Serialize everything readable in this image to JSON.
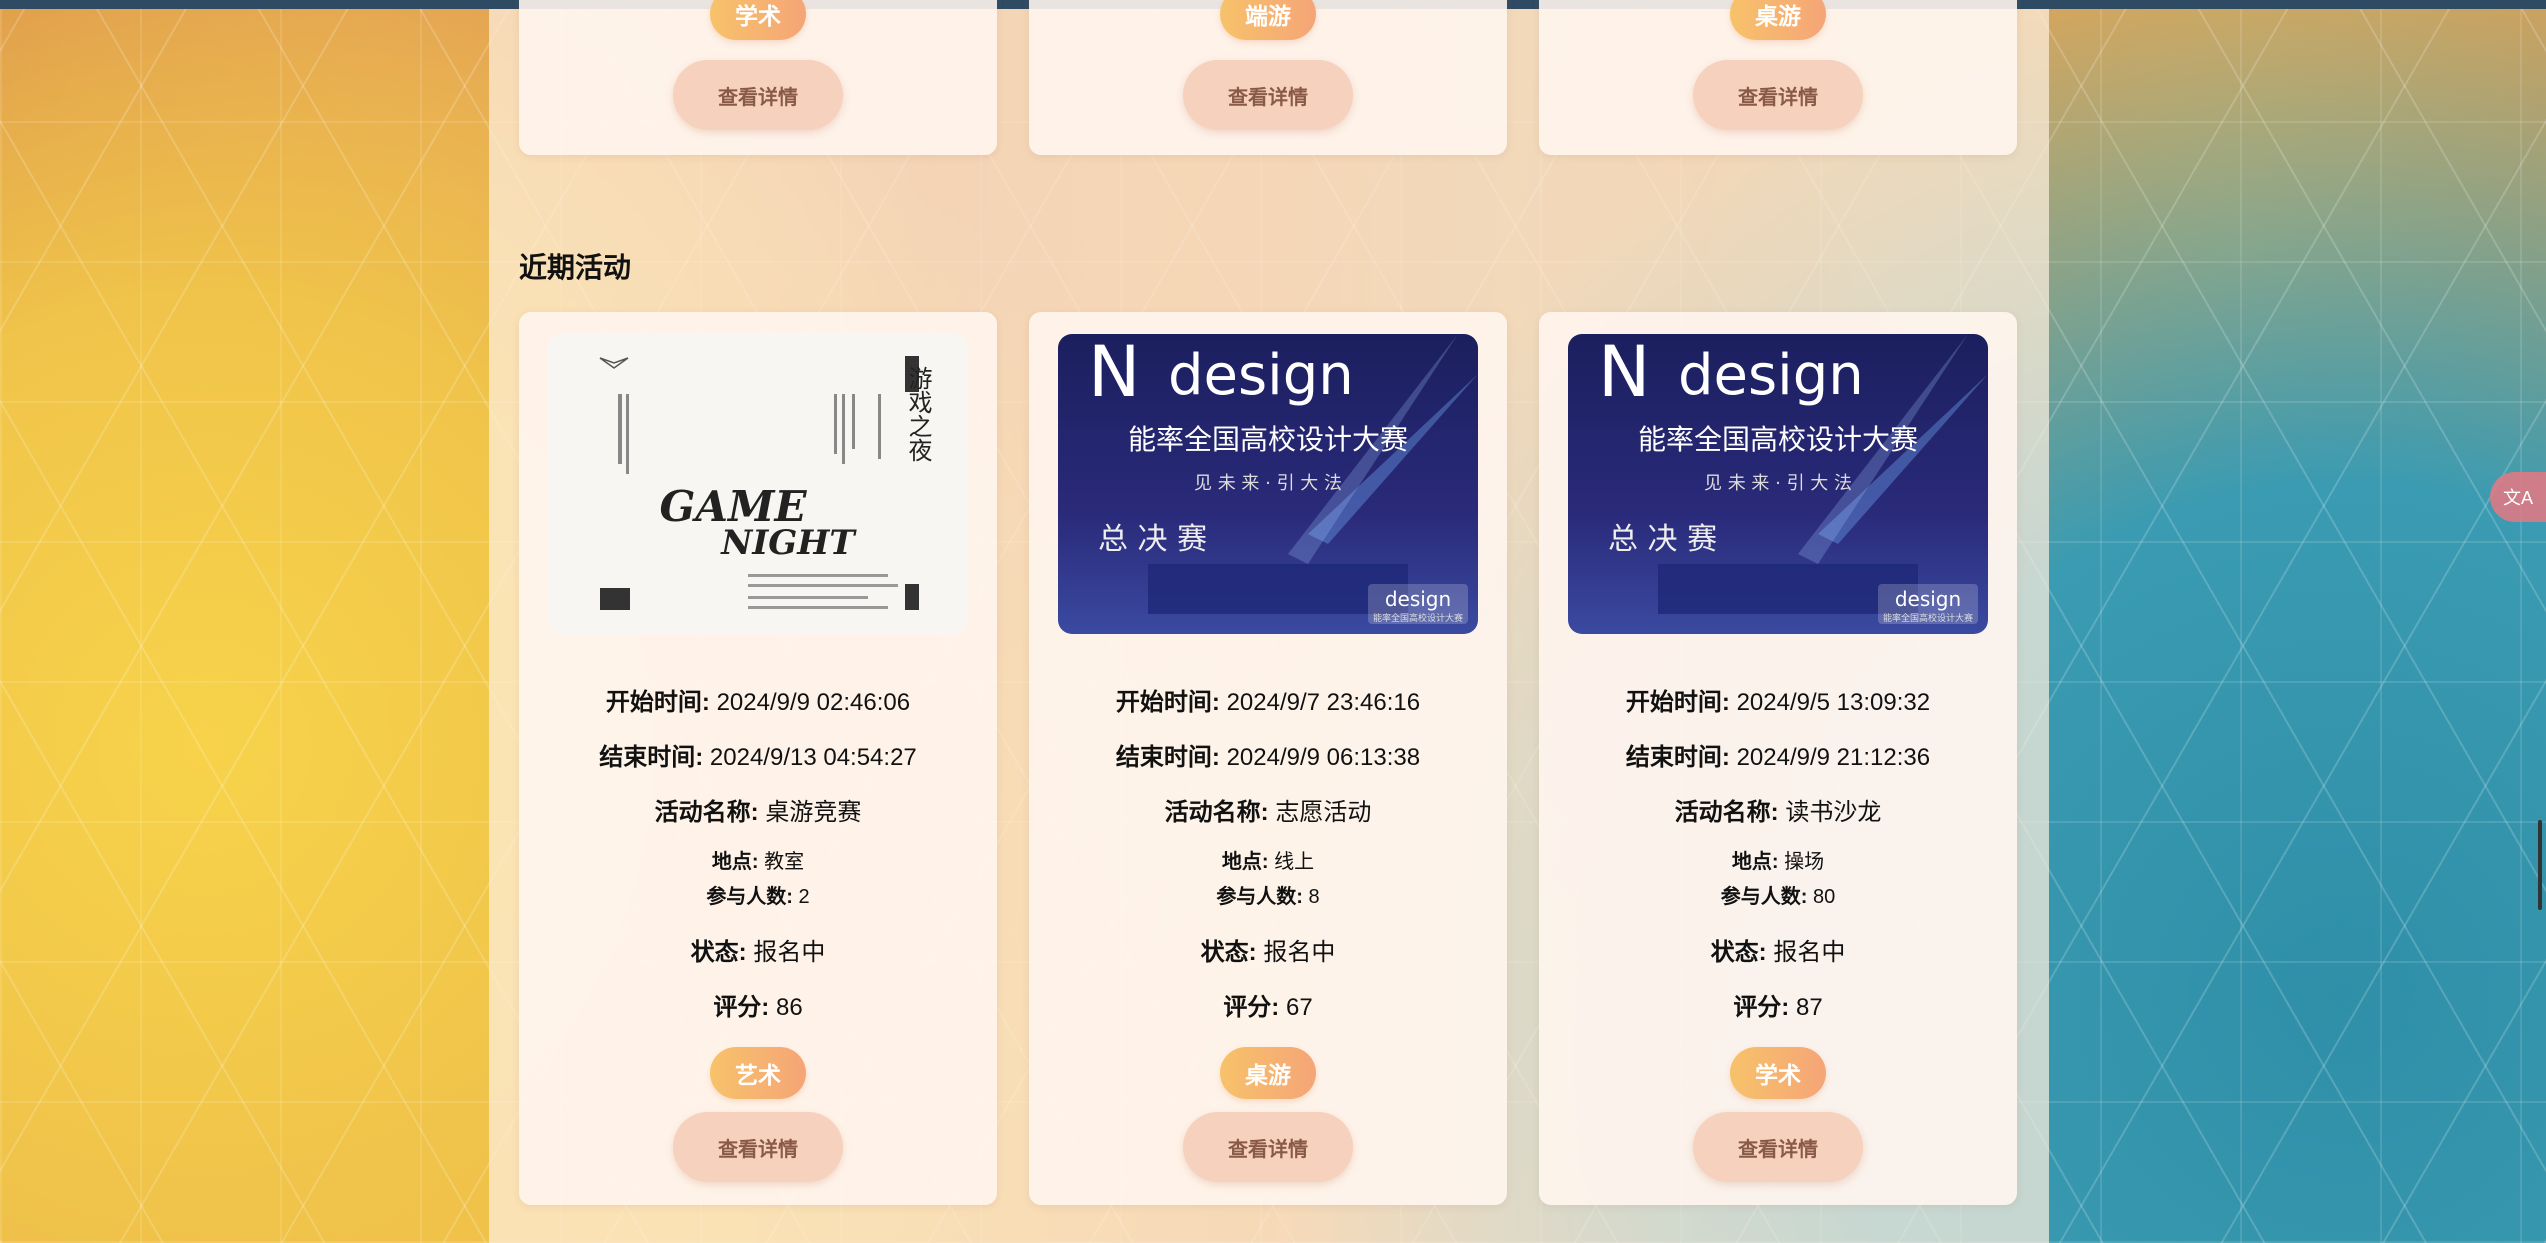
{
  "top_cards": [
    {
      "tag": "学术",
      "detail_label": "查看详情"
    },
    {
      "tag": "端游",
      "detail_label": "查看详情"
    },
    {
      "tag": "桌游",
      "detail_label": "查看详情"
    }
  ],
  "recent_section": {
    "title": "近期活动",
    "labels": {
      "start": "开始时间:",
      "end": "结束时间:",
      "name": "活动名称:",
      "location": "地点:",
      "participants": "参与人数:",
      "status": "状态:",
      "score": "评分:"
    },
    "cards": [
      {
        "poster": {
          "kind": "game-night",
          "title_line1": "GAME",
          "title_line2": "NIGHT",
          "cn_title": "游戏之夜"
        },
        "start": "2024/9/9 02:46:06",
        "end": "2024/9/13 04:54:27",
        "name": "桌游竞赛",
        "location": "教室",
        "participants": "2",
        "status": "报名中",
        "score": "86",
        "tag": "艺术",
        "detail_label": "查看详情"
      },
      {
        "poster": {
          "kind": "design",
          "brand": "design",
          "subtitle": "能率全国高校设计大赛",
          "slogan": "见 未 来 · 引 大 法",
          "stage": "总 决 赛",
          "corner": "design",
          "corner_sub": "能率全国高校设计大赛"
        },
        "start": "2024/9/7 23:46:16",
        "end": "2024/9/9 06:13:38",
        "name": "志愿活动",
        "location": "线上",
        "participants": "8",
        "status": "报名中",
        "score": "67",
        "tag": "桌游",
        "detail_label": "查看详情"
      },
      {
        "poster": {
          "kind": "design",
          "brand": "design",
          "subtitle": "能率全国高校设计大赛",
          "slogan": "见 未 来 · 引 大 法",
          "stage": "总 决 赛",
          "corner": "design",
          "corner_sub": "能率全国高校设计大赛"
        },
        "start": "2024/9/5 13:09:32",
        "end": "2024/9/9 21:12:36",
        "name": "读书沙龙",
        "location": "操场",
        "participants": "80",
        "status": "报名中",
        "score": "87",
        "tag": "学术",
        "detail_label": "查看详情"
      }
    ]
  },
  "translate_widget": {
    "icon": "translate-icon",
    "glyph": "文A"
  },
  "colors": {
    "accent_tag": "#f7c26a",
    "button_bg": "#f6d1bd",
    "button_text": "#8a5a48"
  }
}
